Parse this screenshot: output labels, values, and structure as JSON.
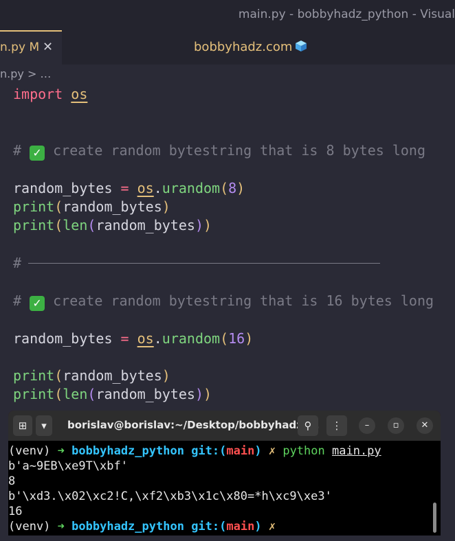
{
  "window": {
    "title": "main.py - bobbyhadz_python - Visual"
  },
  "tab": {
    "name": "n.py",
    "badge": "M",
    "close": "✕"
  },
  "site": {
    "label": "bobbyhadz.com"
  },
  "breadcrumb": {
    "text": "n.py > …"
  },
  "code": {
    "l1_kw": "import",
    "l1_mod": "os",
    "c1_hash": "#",
    "c1_text": "create random bytestring that is 8 bytes long",
    "l3_var": "random_bytes",
    "l3_op": "=",
    "l3_mod": "os",
    "l3_dot": ".",
    "l3_fn": "urandom",
    "l3_num": "8",
    "l4_fn": "print",
    "l4_arg": "random_bytes",
    "l5_fn": "print",
    "l5_len": "len",
    "l5_arg": "random_bytes",
    "sep_hash": "#",
    "c2_hash": "#",
    "c2_text": "create random bytestring that is 16 bytes long",
    "l7_var": "random_bytes",
    "l7_op": "=",
    "l7_mod": "os",
    "l7_dot": ".",
    "l7_fn": "urandom",
    "l7_num": "16",
    "l8_fn": "print",
    "l8_arg": "random_bytes",
    "l9_fn": "print",
    "l9_len": "len",
    "l9_arg": "random_bytes"
  },
  "terminal": {
    "title": "borislav@borislav:~/Desktop/bobbyhadz_...",
    "prompt_env": "(venv)",
    "prompt_arrow": "➜",
    "prompt_dir": "bobbyhadz_python",
    "prompt_git": "git:(",
    "prompt_branch": "main",
    "prompt_git_close": ")",
    "prompt_x": "✗",
    "cmd": "python",
    "cmd_file": "main.py",
    "out1": "b'a~9EB\\xe9T\\xbf'",
    "out2": "8",
    "out3": "b'\\xd3.\\x02\\xc2!C,\\xf2\\xb3\\x1c\\x80=*h\\xc9\\xe3'",
    "out4": "16"
  },
  "colors": {
    "accent": "#e5c07b",
    "terminal_bg": "#000000"
  }
}
